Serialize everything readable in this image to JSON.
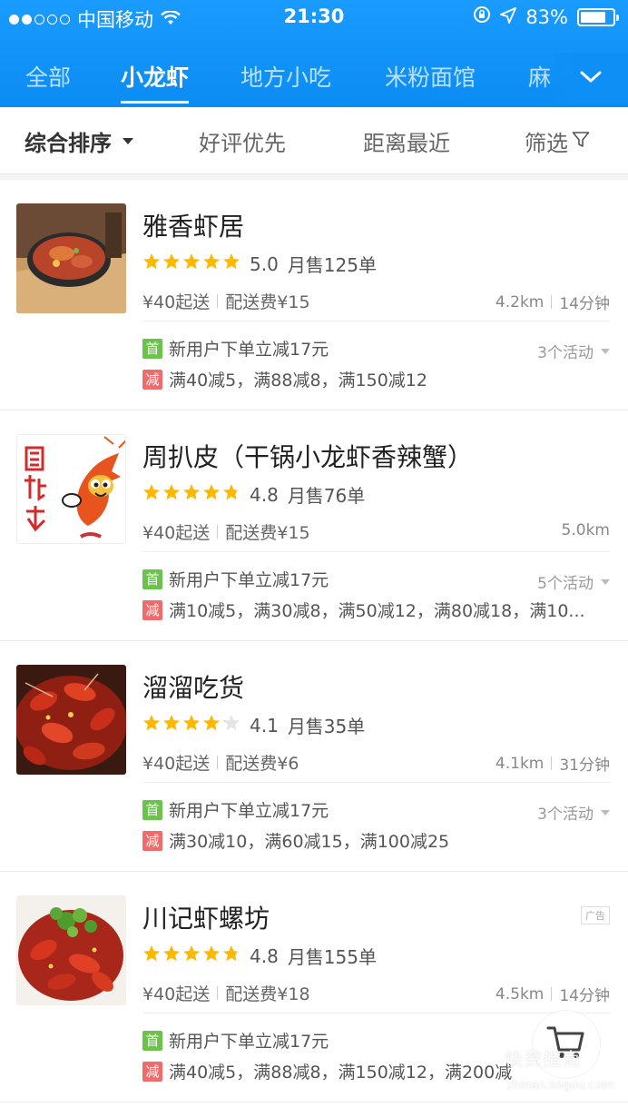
{
  "status_bar": {
    "carrier": "中国移动",
    "time": "21:30",
    "battery": "83%"
  },
  "category_tabs": [
    {
      "label": "全部",
      "active": false
    },
    {
      "label": "小龙虾",
      "active": true
    },
    {
      "label": "地方小吃",
      "active": false
    },
    {
      "label": "米粉面馆",
      "active": false
    },
    {
      "label": "麻",
      "active": false
    }
  ],
  "filters": {
    "sort": "综合排序",
    "good_reviews": "好评优先",
    "nearest": "距离最近",
    "filter": "筛选"
  },
  "shops": [
    {
      "name": "雅香虾居",
      "stars": 5,
      "rating": "5.0",
      "sales": "月售125单",
      "min_order": "¥40起送",
      "delivery_fee": "配送费¥15",
      "distance": "4.2km",
      "time": "14分钟",
      "new_user_badge": "首",
      "new_user_text": "新用户下单立减17元",
      "discount_badge": "减",
      "discount_text": "满40减5，满88减8，满150减12",
      "activities": "3个活动",
      "ad": ""
    },
    {
      "name": "周扒皮（干锅小龙虾香辣蟹）",
      "stars": 4.8,
      "rating": "4.8",
      "sales": "月售76单",
      "min_order": "¥40起送",
      "delivery_fee": "配送费¥15",
      "distance": "5.0km",
      "time": "",
      "new_user_badge": "首",
      "new_user_text": "新用户下单立减17元",
      "discount_badge": "减",
      "discount_text": "满10减5，满30减8，满50减12，满80减18，满10...",
      "activities": "5个活动",
      "ad": ""
    },
    {
      "name": "溜溜吃货",
      "stars": 4.1,
      "rating": "4.1",
      "sales": "月售35单",
      "min_order": "¥40起送",
      "delivery_fee": "配送费¥6",
      "distance": "4.1km",
      "time": "31分钟",
      "new_user_badge": "首",
      "new_user_text": "新用户下单立减17元",
      "discount_badge": "减",
      "discount_text": "满30减10，满60减15，满100减25",
      "activities": "3个活动",
      "ad": ""
    },
    {
      "name": "川记虾螺坊",
      "stars": 4.8,
      "rating": "4.8",
      "sales": "月售155单",
      "min_order": "¥40起送",
      "delivery_fee": "配送费¥18",
      "distance": "4.5km",
      "time": "14分钟",
      "new_user_badge": "首",
      "new_user_text": "新用户下单立减17元",
      "discount_badge": "减",
      "discount_text": "满40减5，满88减8，满150减12，满200减",
      "activities": "",
      "ad": "广告"
    }
  ],
  "watermark": {
    "cn": "快资指南",
    "en": "zhinan.sogou.com"
  },
  "colors": {
    "header_blue": "#0d8ff5",
    "star_yellow": "#ffb800",
    "badge_green": "#6bc34b",
    "badge_red": "#f06b6b"
  }
}
